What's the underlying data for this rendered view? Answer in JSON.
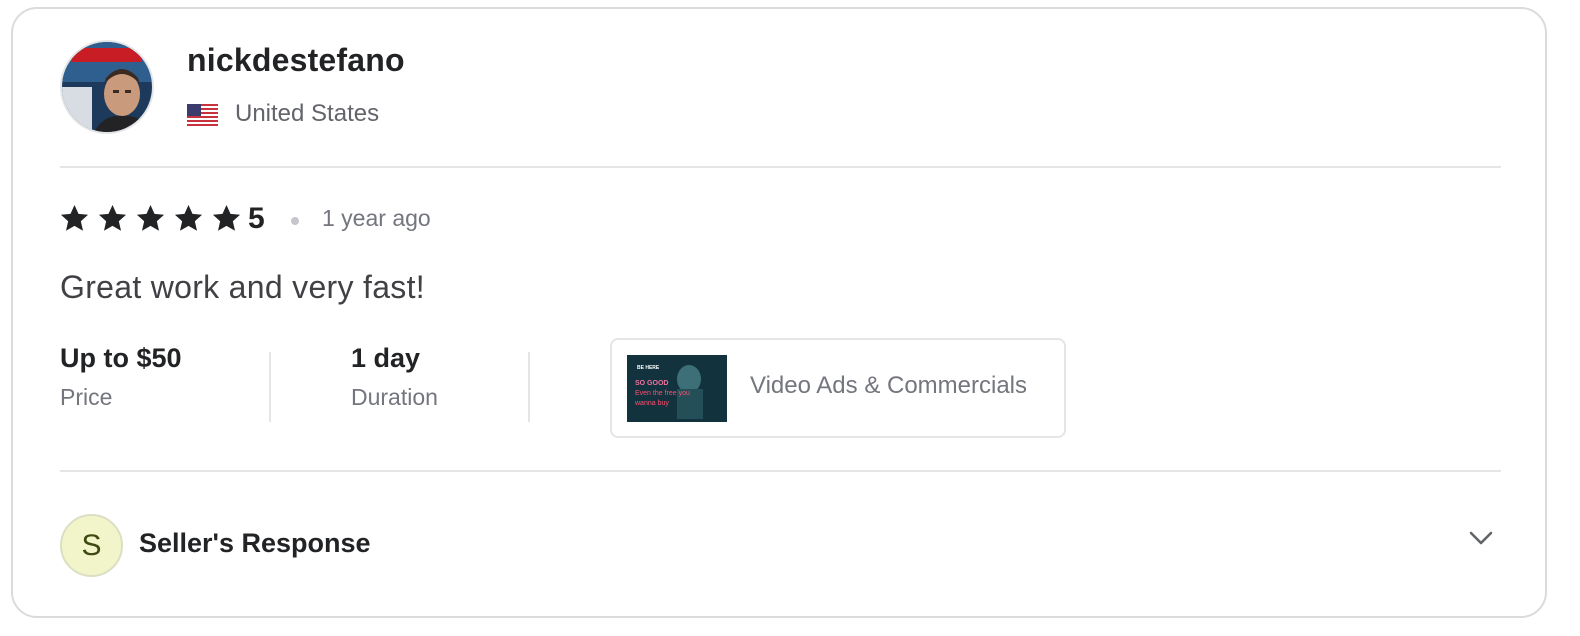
{
  "reviewer": {
    "username": "nickdestefano",
    "country": "United States",
    "avatar_icon": "user-avatar-photo",
    "flag_icon": "us-flag-icon"
  },
  "review": {
    "rating": "5",
    "star_count": 5,
    "time_ago": "1 year ago",
    "text": "Great work and very fast!"
  },
  "meta": {
    "price_value": "Up to $50",
    "price_label": "Price",
    "duration_value": "1 day",
    "duration_label": "Duration"
  },
  "gig": {
    "title": "Video Ads & Commercials",
    "thumbnail_text": [
      "BE HERE",
      "SO GOOD",
      "Even the free you",
      "wanna buy"
    ]
  },
  "seller_response": {
    "initial": "S",
    "label": "Seller's Response",
    "toggle_icon": "chevron-down-icon"
  },
  "colors": {
    "star": "#222325",
    "response_avatar_bg": "#f1f5c9",
    "border": "#dadbdd"
  }
}
